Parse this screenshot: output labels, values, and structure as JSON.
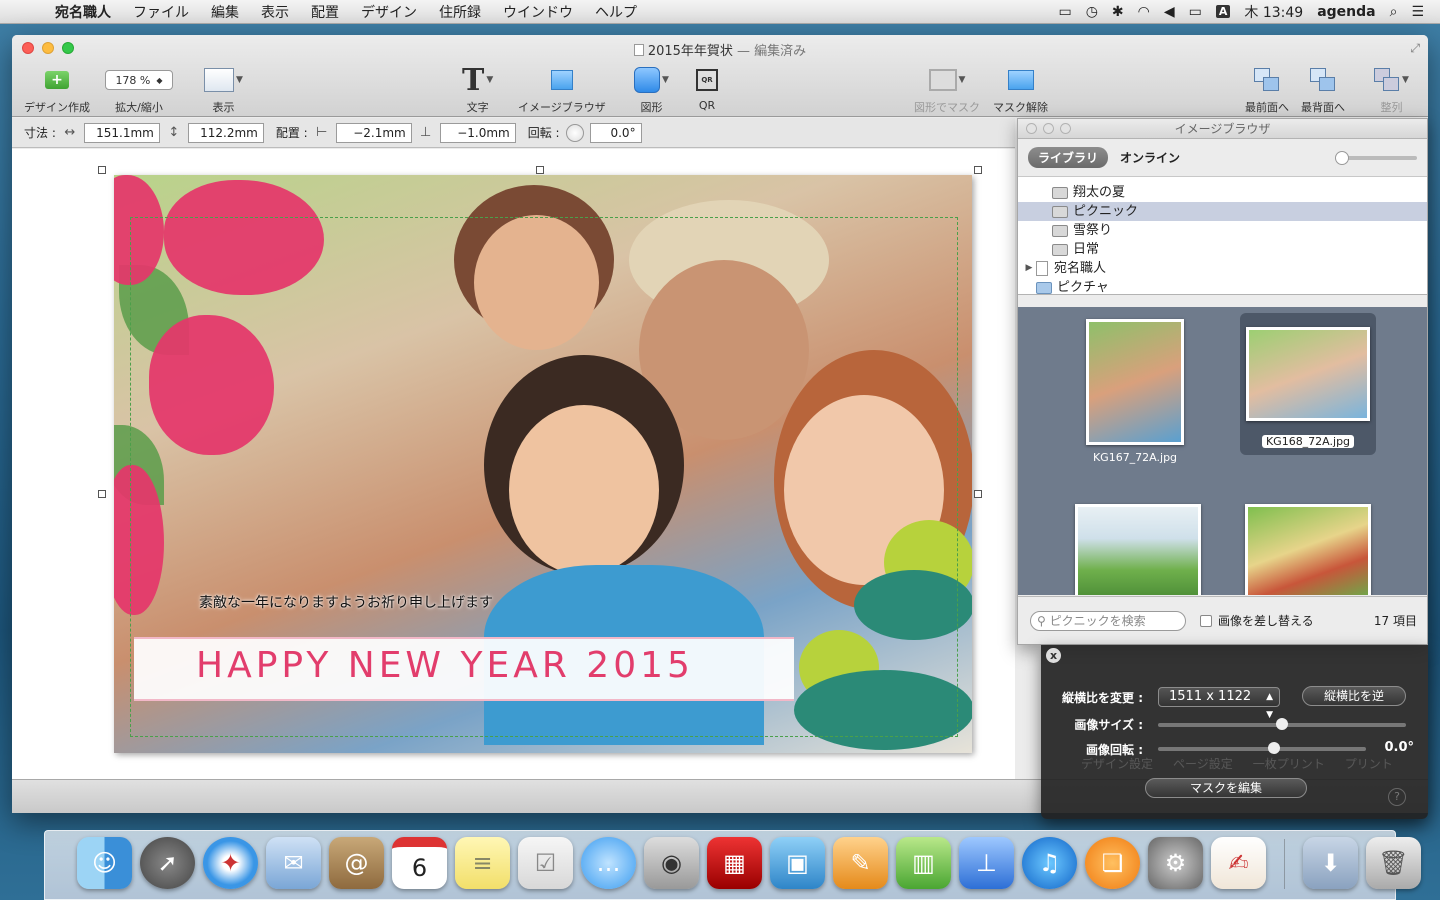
{
  "menubar": {
    "apple": "",
    "items": [
      "宛名職人",
      "ファイル",
      "編集",
      "表示",
      "配置",
      "デザイン",
      "住所録",
      "ウインドウ",
      "ヘルプ"
    ],
    "clock": "木 13:49",
    "input_indicator": "A",
    "user": "agenda"
  },
  "window": {
    "title": "2015年年賀状",
    "title_suffix": "— 編集済み"
  },
  "toolbar": {
    "create": "デザイン作成",
    "zoom_value": "178 %",
    "zoom_label": "拡大/縮小",
    "view": "表示",
    "text": "文字",
    "image_browser": "イメージブラウザ",
    "shape": "図形",
    "qr_icon": "QR",
    "qr": "QR",
    "shape_mask": "図形でマスク",
    "mask_release": "マスク解除",
    "bring_front": "最前面へ",
    "send_back": "最背面へ",
    "align": "整列"
  },
  "dimensions": {
    "size_label": "寸法 :",
    "width": "151.1mm",
    "height": "112.2mm",
    "position_label": "配置 :",
    "x": "−2.1mm",
    "y": "−1.0mm",
    "rotation_label": "回転 :",
    "rotation": "0.0°"
  },
  "card": {
    "message": "素敵な一年になりますようお祈り申し上げます",
    "greeting": "HAPPY NEW YEAR 2015"
  },
  "image_browser": {
    "title": "イメージブラウザ",
    "tab_library": "ライブラリ",
    "tab_online": "オンライン",
    "tree": [
      {
        "label": "翔太の夏",
        "selected": false
      },
      {
        "label": "ピクニック",
        "selected": true
      },
      {
        "label": "雪祭り",
        "selected": false
      },
      {
        "label": "日常",
        "selected": false
      },
      {
        "label": "宛名職人",
        "selected": false
      },
      {
        "label": "ピクチャ",
        "selected": false
      }
    ],
    "thumbnails": [
      {
        "name": "KG167_72A.jpg",
        "selected": false
      },
      {
        "name": "KG168_72A.jpg",
        "selected": true
      },
      {
        "name": "",
        "selected": false
      },
      {
        "name": "",
        "selected": false
      }
    ],
    "search_placeholder": "ピクニックを検索",
    "replace_label": "画像を差し替える",
    "count": "17 項目"
  },
  "hud": {
    "close": "x",
    "aspect_label": "縦横比を変更 :",
    "aspect_value": "1511 x 1122",
    "swap_button": "縦横比を逆",
    "size_label": "画像サイズ :",
    "size_level": 0.5,
    "rotation_label": "画像回転 :",
    "rotation_level": 0.56,
    "rotation_value": "0.0°",
    "edit_mask": "マスクを編集",
    "ghost_tabs": [
      "デザイン設定",
      "ページ設定",
      "一枚プリント",
      "プリント"
    ],
    "help": "?"
  },
  "dock": {
    "icons": [
      "finder-icon",
      "launchpad-icon",
      "safari-icon",
      "mail-icon",
      "contacts-icon",
      "calendar-icon",
      "notes-icon",
      "reminders-icon",
      "messages-icon",
      "facetime-icon",
      "photo-booth-icon",
      "iphoto-icon",
      "pages-icon",
      "numbers-icon",
      "keynote-icon",
      "itunes-icon",
      "ibooks-icon",
      "system-preferences-icon",
      "atena-shokunin-icon",
      "downloads-icon",
      "trash-icon"
    ],
    "calendar_day": "6"
  },
  "colors": {
    "accent_pink": "#e23d6c",
    "selection": "#c8cfe0"
  }
}
